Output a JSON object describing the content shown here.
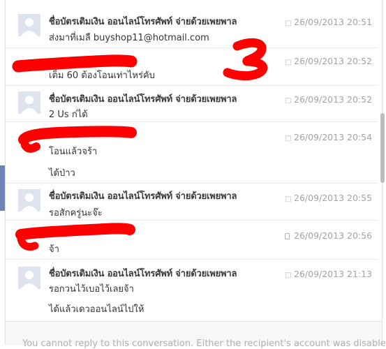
{
  "messages": [
    {
      "sender": "ชื่อบัตรเติมเงิน ออนไลน์โทรศัพท์ จ่ายด้วยเพยพาล",
      "lines": [
        "ส่งมาที่เมลื buyshop11@hotmail.com"
      ],
      "time": "26/09/2013 20:51",
      "icon": "speech-bubble-icon"
    },
    {
      "sender": "",
      "lines": [
        "เต็ม 60 ต้องโอนเท่าไหร่คับ"
      ],
      "time": "26/09/2013 20:52",
      "icon": "speech-bubble-icon"
    },
    {
      "sender": "ชื่อบัตรเติมเงิน ออนไลน์โทรศัพท์ จ่ายด้วยเพยพาล",
      "lines": [
        "2 Us ก่ได้"
      ],
      "time": "26/09/2013 20:52",
      "icon": "speech-bubble-icon"
    },
    {
      "sender": "",
      "lines": [
        "โอนแล้วจร้า",
        "ได้ป่าว"
      ],
      "time": "26/09/2013 20:54",
      "icon": "speech-bubble-icon"
    },
    {
      "sender": "ชื่อบัตรเติมเงิน ออนไลน์โทรศัพท์ จ่ายด้วยเพยพาล",
      "lines": [
        "รอสักครู่นะจ๊ะ"
      ],
      "time": "26/09/2013 20:55",
      "icon": "speech-bubble-icon"
    },
    {
      "sender": "",
      "lines": [
        "จ้า"
      ],
      "time": "26/09/2013 20:56",
      "icon": "mobile-phone-icon"
    },
    {
      "sender": "ชื่อบัตรเติมเงิน ออนไลน์โทรศัพท์ จ่ายด้วยเพยพาล",
      "lines": [
        "รอกวนไว้เบอไว้เลยจ้า",
        "ได้แล้วเดวออนไลน์ไปให้"
      ],
      "time": "26/09/2013 21:13",
      "icon": "speech-bubble-icon"
    }
  ],
  "annotation": {
    "digit": "3"
  },
  "footer": {
    "text": "You cannot reply to this conversation. Either the recipient's account was disabled"
  },
  "colors": {
    "redaction": "#ff0000",
    "sender": "#3b3b3b",
    "timestamp": "#a3a3a3"
  }
}
